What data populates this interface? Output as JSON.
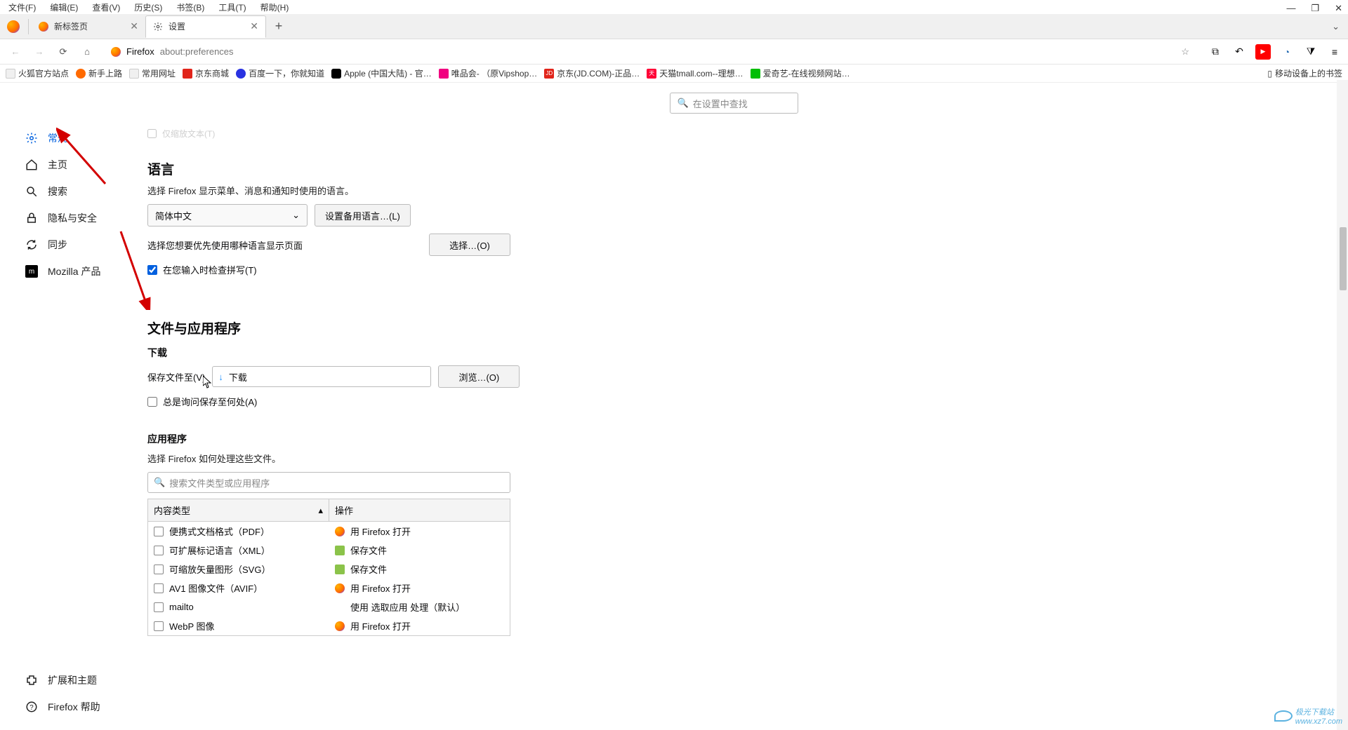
{
  "menubar": [
    "文件(F)",
    "编辑(E)",
    "查看(V)",
    "历史(S)",
    "书签(B)",
    "工具(T)",
    "帮助(H)"
  ],
  "tabs": {
    "tab1": "新标签页",
    "tab2": "设置"
  },
  "url": {
    "site": "Firefox",
    "path": "about:preferences"
  },
  "bookmarks": [
    "火狐官方站点",
    "新手上路",
    "常用网址",
    "京东商城",
    "百度一下，你就知道",
    "Apple (中国大陆) - 官…",
    "唯品会- （原Vipshop…",
    "京东(JD.COM)-正品…",
    "天猫tmall.com--理想…",
    "爱奇艺-在线视频网站…"
  ],
  "bookmarks_right": "移动设备上的书签",
  "sidebar": {
    "items": [
      {
        "label": "常规"
      },
      {
        "label": "主页"
      },
      {
        "label": "搜索"
      },
      {
        "label": "隐私与安全"
      },
      {
        "label": "同步"
      },
      {
        "label": "Mozilla 产品"
      }
    ],
    "bottom": [
      {
        "label": "扩展和主题"
      },
      {
        "label": "Firefox 帮助"
      }
    ]
  },
  "search_placeholder": "在设置中查找",
  "truncated_top": "仅缩放文本(T)",
  "lang": {
    "heading": "语言",
    "desc": "选择 Firefox 显示菜单、消息和通知时使用的语言。",
    "select_value": "简体中文",
    "alt_btn": "设置备用语言…(L)",
    "pref_desc": "选择您想要优先使用哪种语言显示页面",
    "choose_btn": "选择…(O)",
    "spellcheck": "在您输入时检查拼写(T)"
  },
  "files": {
    "heading": "文件与应用程序",
    "dl_heading": "下载",
    "save_label": "保存文件至(V)",
    "path_value": "下载",
    "browse_btn": "浏览…(O)",
    "ask_label": "总是询问保存至何处(A)"
  },
  "apps": {
    "heading": "应用程序",
    "desc": "选择 Firefox 如何处理这些文件。",
    "search_placeholder": "搜索文件类型或应用程序",
    "col_type": "内容类型",
    "col_action": "操作",
    "rows": [
      {
        "type": "便携式文档格式（PDF）",
        "action": "用 Firefox 打开",
        "action_kind": "ff"
      },
      {
        "type": "可扩展标记语言（XML）",
        "action": "保存文件",
        "action_kind": "save"
      },
      {
        "type": "可缩放矢量图形（SVG）",
        "action": "保存文件",
        "action_kind": "save"
      },
      {
        "type": "AV1 图像文件（AVIF）",
        "action": "用 Firefox 打开",
        "action_kind": "ff"
      },
      {
        "type": "mailto",
        "action": "使用 选取应用 处理（默认）",
        "action_kind": "none"
      },
      {
        "type": "WebP 图像",
        "action": "用 Firefox 打开",
        "action_kind": "ff"
      }
    ]
  },
  "watermark": {
    "brand": "极光下载站",
    "url": "www.xz7.com"
  }
}
